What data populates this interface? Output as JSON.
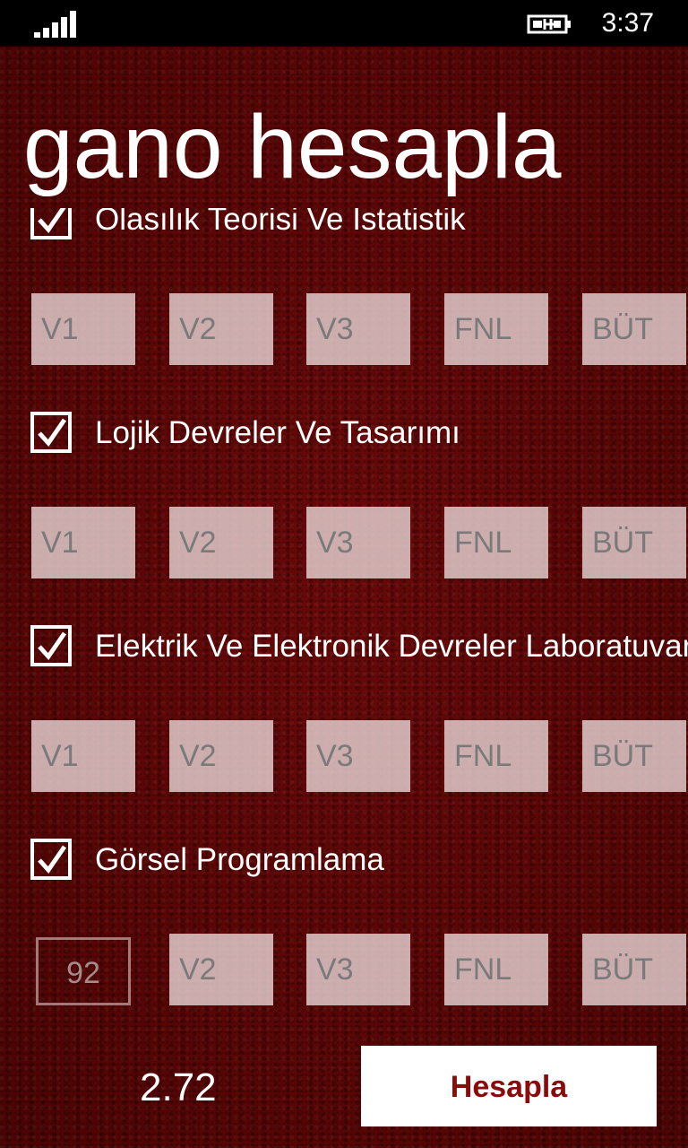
{
  "status_bar": {
    "time": "3:37"
  },
  "app": {
    "title": "gano hesapla"
  },
  "courses": [
    {
      "name": "Olasılık Teorisi Ve İstatistik",
      "checked": true,
      "grades": [
        {
          "label": "V1",
          "value": ""
        },
        {
          "label": "V2",
          "value": ""
        },
        {
          "label": "V3",
          "value": ""
        },
        {
          "label": "FNL",
          "value": ""
        },
        {
          "label": "BÜT",
          "value": ""
        }
      ]
    },
    {
      "name": "Lojik Devreler Ve Tasarımı",
      "checked": true,
      "grades": [
        {
          "label": "V1",
          "value": ""
        },
        {
          "label": "V2",
          "value": ""
        },
        {
          "label": "V3",
          "value": ""
        },
        {
          "label": "FNL",
          "value": ""
        },
        {
          "label": "BÜT",
          "value": ""
        }
      ]
    },
    {
      "name": "Elektrik Ve Elektronik Devreler Laboratuvarı",
      "checked": true,
      "grades": [
        {
          "label": "V1",
          "value": ""
        },
        {
          "label": "V2",
          "value": ""
        },
        {
          "label": "V3",
          "value": ""
        },
        {
          "label": "FNL",
          "value": ""
        },
        {
          "label": "BÜT",
          "value": ""
        }
      ]
    },
    {
      "name": "Görsel Programlama",
      "checked": true,
      "grades": [
        {
          "label": "V1",
          "value": "92"
        },
        {
          "label": "V2",
          "value": ""
        },
        {
          "label": "V3",
          "value": ""
        },
        {
          "label": "FNL",
          "value": ""
        },
        {
          "label": "BÜT",
          "value": ""
        }
      ]
    }
  ],
  "footer": {
    "result": "2.72",
    "calculate_label": "Hesapla"
  }
}
